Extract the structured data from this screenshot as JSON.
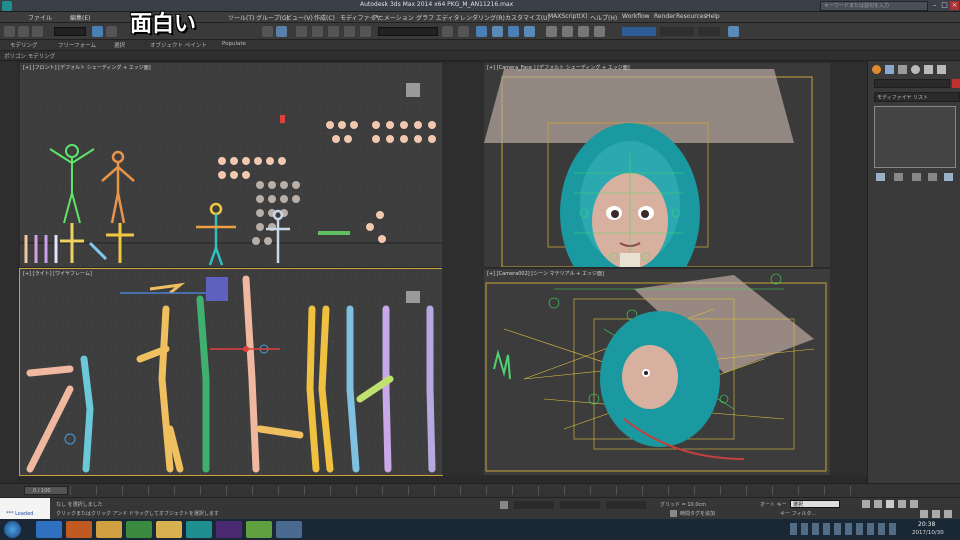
{
  "window": {
    "title": "Autodesk 3ds Max 2014 x64    PKG_M_AN11216.max",
    "search_placeholder": "キーワードまたは語句を入力"
  },
  "caption": "面白い",
  "menu": [
    "ファイル",
    "編集(E)",
    "ツール(T)",
    "グループ(G)",
    "ビュー(V)",
    "作成(C)",
    "モディファイヤ",
    "アニメーション",
    "グラフ エディタ",
    "レンダリング(R)",
    "カスタマイズ(U)",
    "MAXScript(X)",
    "ヘルプ(H)",
    "Workflow",
    "Render",
    "Resources",
    "Help"
  ],
  "ribbon": {
    "tabs": [
      "モデリング",
      "フリーフォーム",
      "選択",
      "オブジェクト ペイント",
      "Populate"
    ],
    "active_label": "ポリゴン モデリング"
  },
  "viewports": {
    "top_left": "[+] [フロント] [デフォルト シェーディング + エッジ面]",
    "top_right": "[+] [Camera_Face ] [デフォルト シェーディング + エッジ面]",
    "bottom_left": "[+] [ライト] [ワイヤフレーム]",
    "bottom_right": "[+] [Camera002] [シーン マテリアル + エッジ面]"
  },
  "cmdpanel": {
    "modifier_list": "モディファイヤ リスト"
  },
  "timeline": {
    "frame": "0 / 100"
  },
  "status": {
    "line1": "なし を選択しました",
    "line2": "クリックまたはクリック アンド ドラッグしてオブジェクトを選択します",
    "maxscript": "*** Loaded",
    "grid": "グリッド = 10.0cm",
    "autokey": "オート キー",
    "setkey": "キー フィルタ...",
    "selected": "選択",
    "add_time_tag": "時間タグを追加"
  },
  "taskbar": {
    "time": "20:38",
    "date": "2017/10/30"
  },
  "colors": {
    "accent": "#c9a33a",
    "viewport_bg": "#3d3d3d",
    "taskbar": "#1a2836"
  }
}
